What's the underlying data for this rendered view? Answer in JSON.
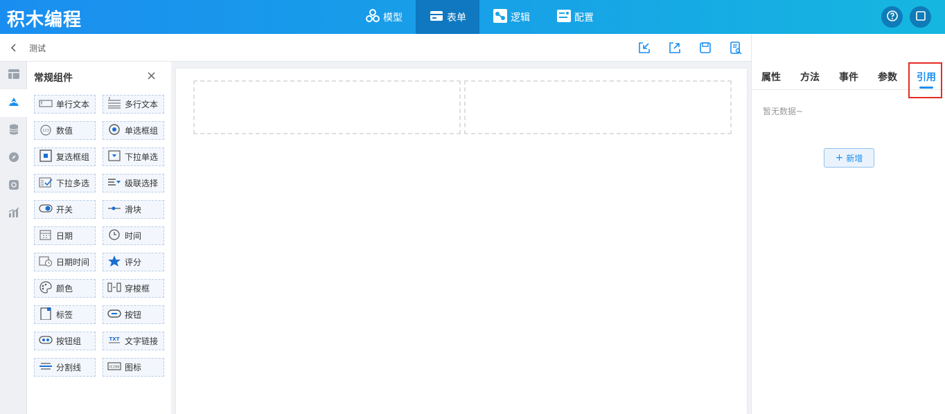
{
  "app": {
    "title": "积木编程"
  },
  "nav": [
    {
      "label": "模型",
      "icon": "model-icon"
    },
    {
      "label": "表单",
      "icon": "form-icon",
      "active": true
    },
    {
      "label": "逻辑",
      "icon": "logic-icon"
    },
    {
      "label": "配置",
      "icon": "config-icon"
    }
  ],
  "header_actions": [
    {
      "icon": "help-icon"
    },
    {
      "icon": "fullscreen-icon"
    }
  ],
  "toolbar": {
    "breadcrumb": "测试",
    "actions": [
      "import-icon",
      "export-icon",
      "save-icon",
      "preview-icon"
    ]
  },
  "icon_bar": [
    "layout-icon",
    "component-icon",
    "database-icon",
    "navigation-icon",
    "settings-icon",
    "chart-icon"
  ],
  "palette": {
    "title": "常规组件",
    "items": [
      {
        "label": "单行文本",
        "icon": "single-line-text-icon"
      },
      {
        "label": "多行文本",
        "icon": "multi-line-text-icon"
      },
      {
        "label": "数值",
        "icon": "number-icon"
      },
      {
        "label": "单选框组",
        "icon": "radio-group-icon"
      },
      {
        "label": "复选框组",
        "icon": "checkbox-group-icon"
      },
      {
        "label": "下拉单选",
        "icon": "select-icon"
      },
      {
        "label": "下拉多选",
        "icon": "multi-select-icon"
      },
      {
        "label": "级联选择",
        "icon": "cascader-icon"
      },
      {
        "label": "开关",
        "icon": "switch-icon"
      },
      {
        "label": "滑块",
        "icon": "slider-icon"
      },
      {
        "label": "日期",
        "icon": "date-icon"
      },
      {
        "label": "时间",
        "icon": "time-icon"
      },
      {
        "label": "日期时间",
        "icon": "datetime-icon"
      },
      {
        "label": "评分",
        "icon": "rate-icon"
      },
      {
        "label": "颜色",
        "icon": "color-icon"
      },
      {
        "label": "穿梭框",
        "icon": "transfer-icon"
      },
      {
        "label": "标签",
        "icon": "tag-icon"
      },
      {
        "label": "按钮",
        "icon": "button-icon"
      },
      {
        "label": "按钮组",
        "icon": "button-group-icon"
      },
      {
        "label": "文字链接",
        "icon": "text-link-icon"
      },
      {
        "label": "分割线",
        "icon": "divider-icon"
      },
      {
        "label": "图标",
        "icon": "icon-icon"
      }
    ]
  },
  "right_panel": {
    "tabs": [
      {
        "label": "属性"
      },
      {
        "label": "方法"
      },
      {
        "label": "事件"
      },
      {
        "label": "参数"
      },
      {
        "label": "引用",
        "active": true
      }
    ],
    "empty_text": "暂无数据~",
    "add_button": "新增"
  },
  "colors": {
    "primary": "#1a8ef0",
    "highlight": "#e52b24"
  }
}
